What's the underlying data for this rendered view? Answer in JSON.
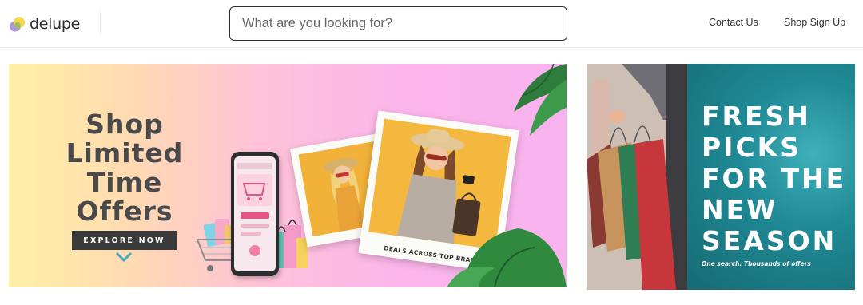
{
  "header": {
    "logo_text": "delupe",
    "search_placeholder": "What are you looking for?",
    "nav": {
      "contact_label": "Contact Us",
      "signup_label": "Shop Sign Up"
    }
  },
  "hero": {
    "headline": [
      "Shop",
      "Limited",
      "Time Offers"
    ],
    "cta_label": "EXPLORE NOW",
    "photo_caption": "DEALS ACROSS TOP BRANDS"
  },
  "side_banner": {
    "headline": [
      "FRESH",
      "PICKS",
      "FOR THE",
      "NEW",
      "SEASON"
    ],
    "tagline": "One search. Thousands of offers"
  },
  "colors": {
    "teal": "#1e7c86",
    "cta_background": "#3a3a3a",
    "search_border": "#2d2d2d",
    "chevron": "#3fa9c4"
  },
  "icons": {
    "logo_mark": "delupe-logo-icon",
    "scroll_hint": "chevron-down-icon"
  }
}
